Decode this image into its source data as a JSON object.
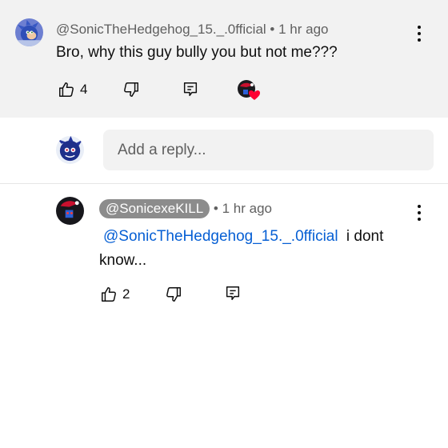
{
  "comment": {
    "handle": "@SonicTheHedgehog_15._.0fficial",
    "separator": "•",
    "time": "1 hr ago",
    "text": "Bro, why this guy bully you but not me???",
    "like_count": "4",
    "icons": {
      "like": "thumbs-up-icon",
      "dislike": "thumbs-down-icon",
      "reply": "reply-icon",
      "creator_heart": "creator-heart-icon",
      "more": "kebab-icon"
    }
  },
  "reply_input": {
    "placeholder": "Add a reply..."
  },
  "reply": {
    "handle": "@SonicexeKILL",
    "separator": "•",
    "time": "1 hr ago",
    "mention": "@SonicTheHedgehog_15._.0fficial",
    "text": "i dont know...",
    "like_count": "2"
  },
  "colors": {
    "highlight_bg": "#f2f2f2",
    "mention": "#065fd4",
    "creator_heart": "#ff0033",
    "handle_chip": "#8c8c8c"
  }
}
